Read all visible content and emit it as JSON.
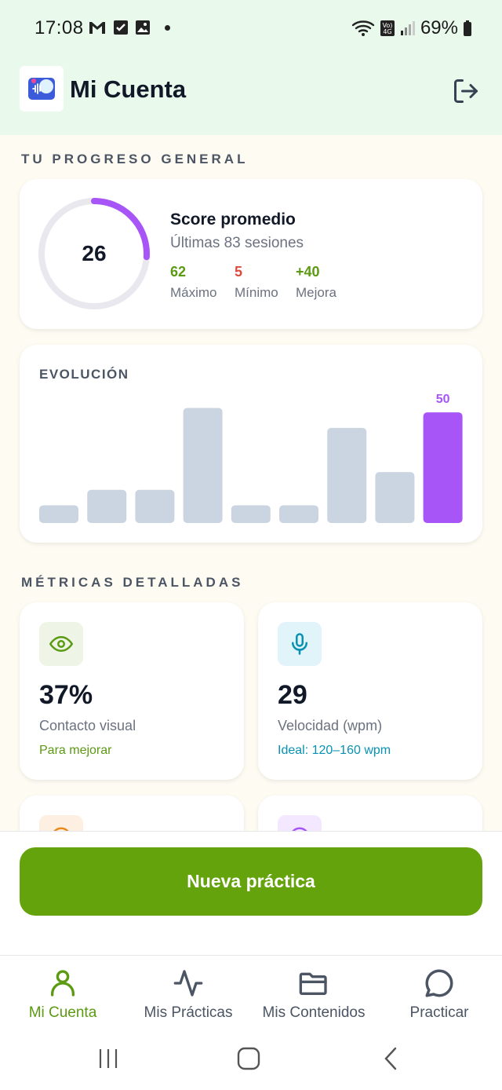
{
  "status_bar": {
    "time": "17:08",
    "battery": "69%",
    "left_icons": [
      "gmail-icon",
      "checkbox-icon",
      "gallery-icon",
      "dot-icon"
    ],
    "right_icons": [
      "wifi-icon",
      "volte-icon",
      "signal-icon",
      "battery-icon"
    ]
  },
  "header": {
    "title": "Mi Cuenta",
    "logo_icon": "app-logo",
    "logout_icon": "logout-icon"
  },
  "progress": {
    "section_label": "TU PROGRESO GENERAL",
    "score": "26",
    "score_fraction": 0.26,
    "title": "Score promedio",
    "subtitle": "Últimas 83 sesiones",
    "stats": [
      {
        "value": "62",
        "label": "Máximo",
        "color": "#5b9a12"
      },
      {
        "value": "5",
        "label": "Mínimo",
        "color": "#dc4a3d"
      },
      {
        "value": "+40",
        "label": "Mejora",
        "color": "#5b9a12"
      }
    ],
    "ring_color": "#a855f7",
    "track_color": "#e8e8ee"
  },
  "evolution": {
    "title": "EVOLUCIÓN",
    "highlight_label": "50"
  },
  "chart_data": {
    "type": "bar",
    "title": "EVOLUCIÓN",
    "values": [
      8,
      15,
      15,
      52,
      8,
      8,
      43,
      23,
      50
    ],
    "ylim": [
      0,
      55
    ],
    "highlight_index": 8,
    "bar_color": "#cbd5e1",
    "highlight_color": "#a855f7",
    "data_labels": [
      "",
      "",
      "",
      "",
      "",
      "",
      "",
      "",
      "50"
    ]
  },
  "metrics": {
    "section_label": "MÉTRICAS DETALLADAS",
    "items": [
      {
        "icon": "eye-icon",
        "value": "37%",
        "label": "Contacto visual",
        "note": "Para mejorar",
        "note_color": "#5b9a12",
        "icon_bg": "#eef5e6",
        "icon_color": "#5b9a12"
      },
      {
        "icon": "microphone-icon",
        "value": "29",
        "label": "Velocidad (wpm)",
        "note": "Ideal: 120–160 wpm",
        "note_color": "#0891b2",
        "icon_bg": "#e0f4fa",
        "icon_color": "#0891b2"
      }
    ]
  },
  "cta": {
    "label": "Nueva práctica",
    "color": "#65a30d"
  },
  "bottom_nav": {
    "items": [
      {
        "icon": "user-icon",
        "label": "Mi Cuenta",
        "active": true
      },
      {
        "icon": "activity-icon",
        "label": "Mis Prácticas",
        "active": false
      },
      {
        "icon": "folder-icon",
        "label": "Mis Contenidos",
        "active": false
      },
      {
        "icon": "chat-icon",
        "label": "Practicar",
        "active": false
      }
    ],
    "active_color": "#5b9a12",
    "inactive_color": "#4b5563"
  },
  "system_nav": {
    "buttons": [
      "recents-icon",
      "home-icon",
      "back-icon"
    ]
  }
}
